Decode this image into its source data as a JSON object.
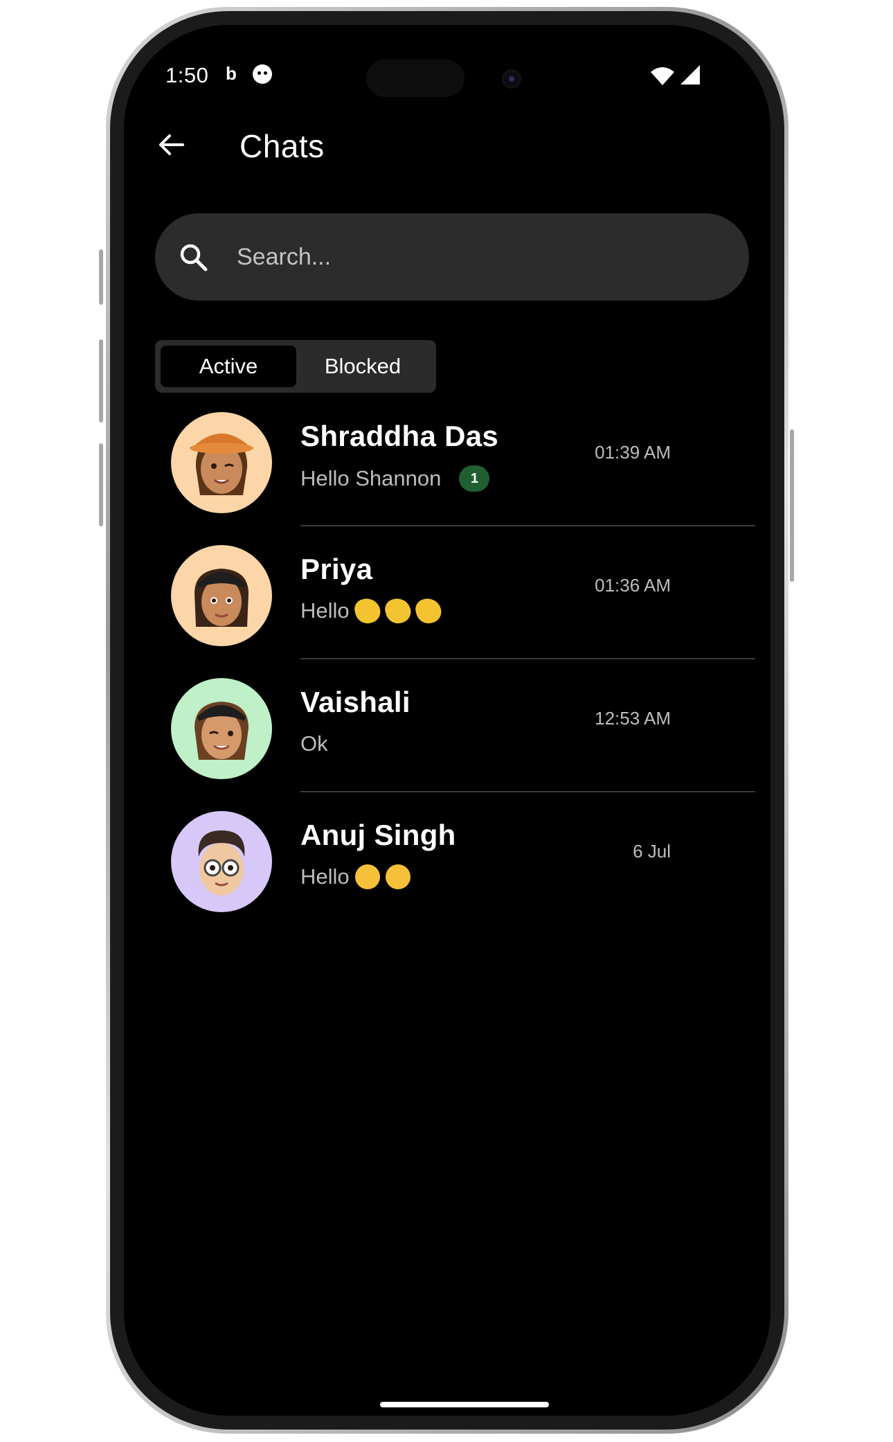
{
  "status_bar": {
    "time": "1:50",
    "indicator_b": "b",
    "icons": [
      "face-icon",
      "wifi-icon",
      "signal-icon"
    ]
  },
  "header": {
    "back_icon": "arrow-left-icon",
    "title": "Chats"
  },
  "search": {
    "placeholder": "Search...",
    "icon": "search-icon"
  },
  "tabs": [
    {
      "label": "Active",
      "selected": true
    },
    {
      "label": "Blocked",
      "selected": false
    }
  ],
  "chats": [
    {
      "name": "Shraddha Das",
      "message": "Hello Shannon",
      "emojis": "",
      "unread": "1",
      "time": "01:39 AM",
      "avatar_bg": "#fcd6a8"
    },
    {
      "name": "Priya",
      "message": "Hello",
      "emojis": "wave-emoji x3",
      "unread": "",
      "time": "01:36 AM",
      "avatar_bg": "#fcd6a8"
    },
    {
      "name": "Vaishali",
      "message": "Ok",
      "emojis": "",
      "unread": "",
      "time": "12:53 AM",
      "avatar_bg": "#bff0c8"
    },
    {
      "name": "Anuj Singh",
      "message": "Hello",
      "emojis": "hug-emoji x2",
      "unread": "",
      "time": "6 Jul",
      "avatar_bg": "#d8c8f8"
    }
  ],
  "colors": {
    "background": "#000000",
    "search_bg": "#2c2c2c",
    "badge_bg": "#1f5f31",
    "divider": "#3a3a3a",
    "text_secondary": "#bdbdbd"
  }
}
